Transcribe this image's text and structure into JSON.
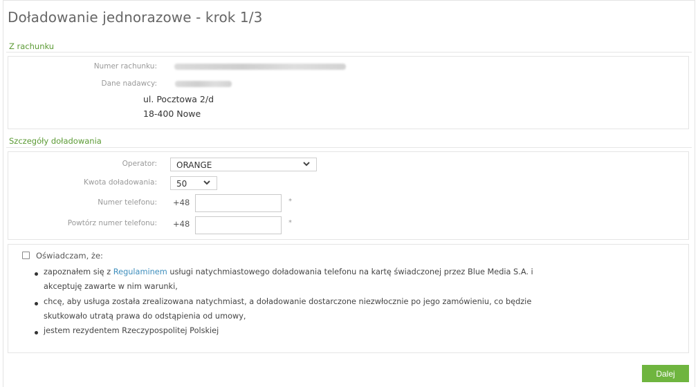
{
  "page_title": "Doładowanie jednorazowe - krok 1/3",
  "from_account": {
    "section_label": "Z rachunku",
    "account_number_label": "Numer rachunku:",
    "sender_data_label": "Dane nadawcy:",
    "address_line1": "ul. Pocztowa 2/d",
    "address_line2": "18-400 Nowe"
  },
  "details": {
    "section_label": "Szczegóły doładowania",
    "operator_label": "Operator:",
    "operator_value": "ORANGE",
    "amount_label": "Kwota doładowania:",
    "amount_value": "50",
    "phone_label": "Numer telefonu:",
    "phone_repeat_label": "Powtórz numer telefonu:",
    "phone_prefix": "+48",
    "required_mark": "*"
  },
  "declaration": {
    "head": "Oświadczam, że:",
    "b1_pre": "zapoznałem się z ",
    "b1_link": "Regulaminem",
    "b1_post": " usługi natychmiastowego doładowania telefonu na kartę świadczonej przez Blue Media S.A. i",
    "b1_line2": "akceptuję zawarte w nim warunki,",
    "b2_line1": "chcę, aby usługa została zrealizowana natychmiast, a doładowanie dostarczone niezwłocznie po jego zamówieniu, co będzie",
    "b2_line2": "skutkowało utratą prawa do odstąpienia od umowy,",
    "b3": "jestem rezydentem Rzeczypospolitej Polskiej"
  },
  "next_button": "Dalej"
}
